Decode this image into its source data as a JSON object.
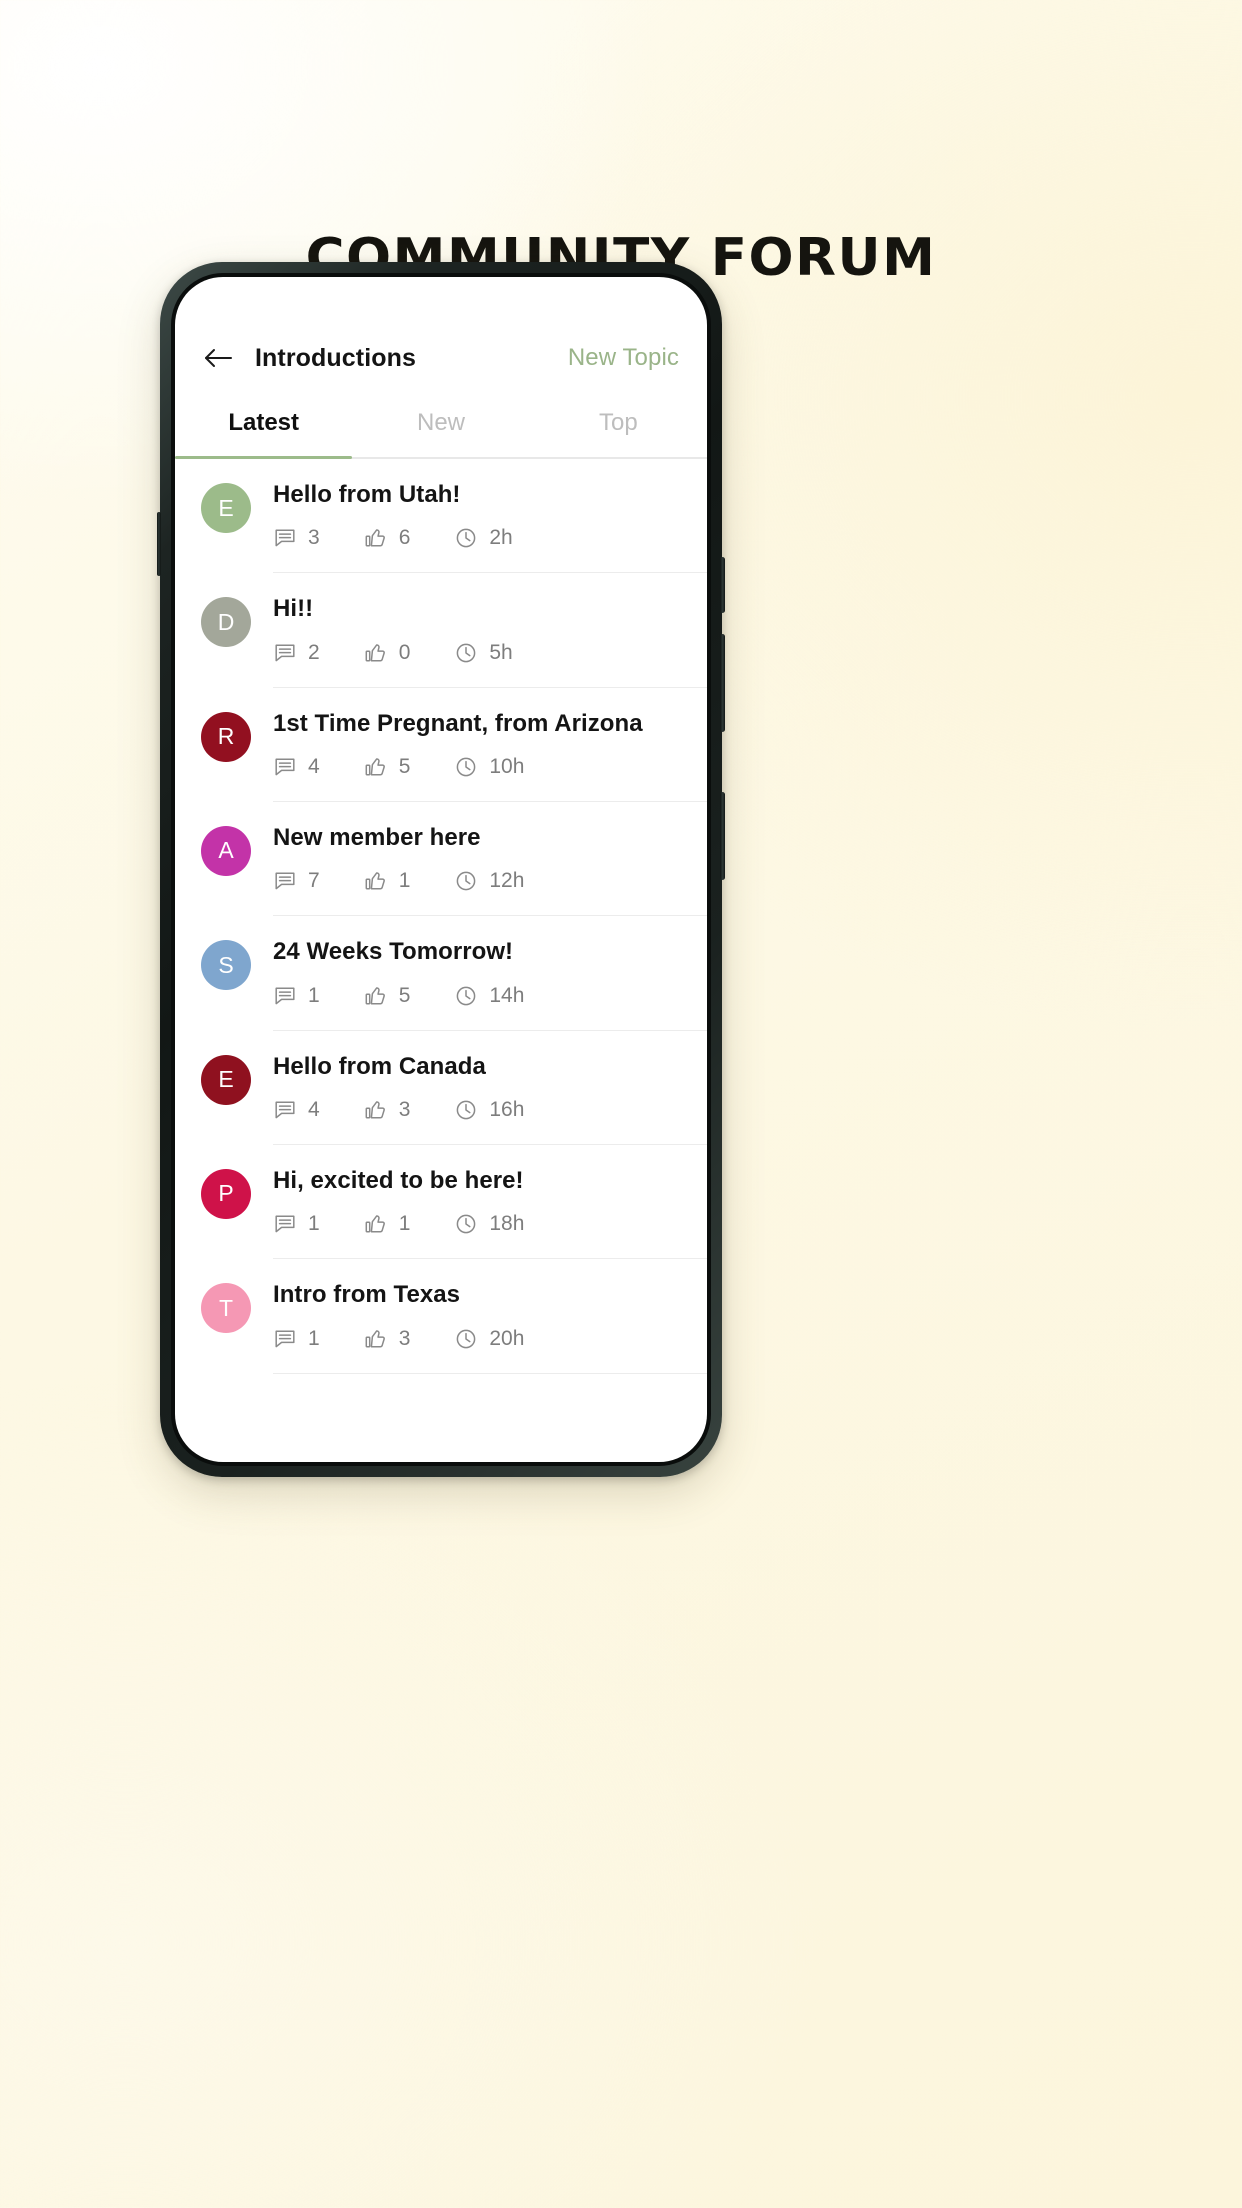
{
  "poster": {
    "title": "COMMUNITY FORUM",
    "background_start": "#fefcf0",
    "background_end": "#fcf5dc"
  },
  "header": {
    "back_icon": "arrow-left-icon",
    "title": "Introductions",
    "action_label": "New Topic",
    "action_color": "#9ab489"
  },
  "tabs": {
    "active_index": 0,
    "indicator_color": "#9cbb8a",
    "items": [
      {
        "label": "Latest"
      },
      {
        "label": "New"
      },
      {
        "label": "Top"
      }
    ]
  },
  "icons": {
    "comment": "comment-icon",
    "like": "thumbs-up-icon",
    "time": "clock-icon"
  },
  "topics": [
    {
      "initial": "E",
      "avatar_color": "#9cbb8a",
      "title": "Hello from Utah!",
      "comments": "3",
      "likes": "6",
      "time": "2h"
    },
    {
      "initial": "D",
      "avatar_color": "#a3a79a",
      "title": "Hi!!",
      "comments": "2",
      "likes": "0",
      "time": "5h"
    },
    {
      "initial": "R",
      "avatar_color": "#921020",
      "title": "1st Time Pregnant, from Arizona",
      "comments": "4",
      "likes": "5",
      "time": "10h"
    },
    {
      "initial": "A",
      "avatar_color": "#c333a8",
      "title": "New member here",
      "comments": "7",
      "likes": "1",
      "time": "12h"
    },
    {
      "initial": "S",
      "avatar_color": "#7fa6ce",
      "title": "24 Weeks Tomorrow!",
      "comments": "1",
      "likes": "5",
      "time": "14h"
    },
    {
      "initial": "E",
      "avatar_color": "#8f111f",
      "title": "Hello from Canada",
      "comments": "4",
      "likes": "3",
      "time": "16h"
    },
    {
      "initial": "P",
      "avatar_color": "#cf1249",
      "title": "Hi, excited to be here!",
      "comments": "1",
      "likes": "1",
      "time": "18h"
    },
    {
      "initial": "T",
      "avatar_color": "#f598b4",
      "title": "Intro from Texas",
      "comments": "1",
      "likes": "3",
      "time": "20h"
    }
  ]
}
